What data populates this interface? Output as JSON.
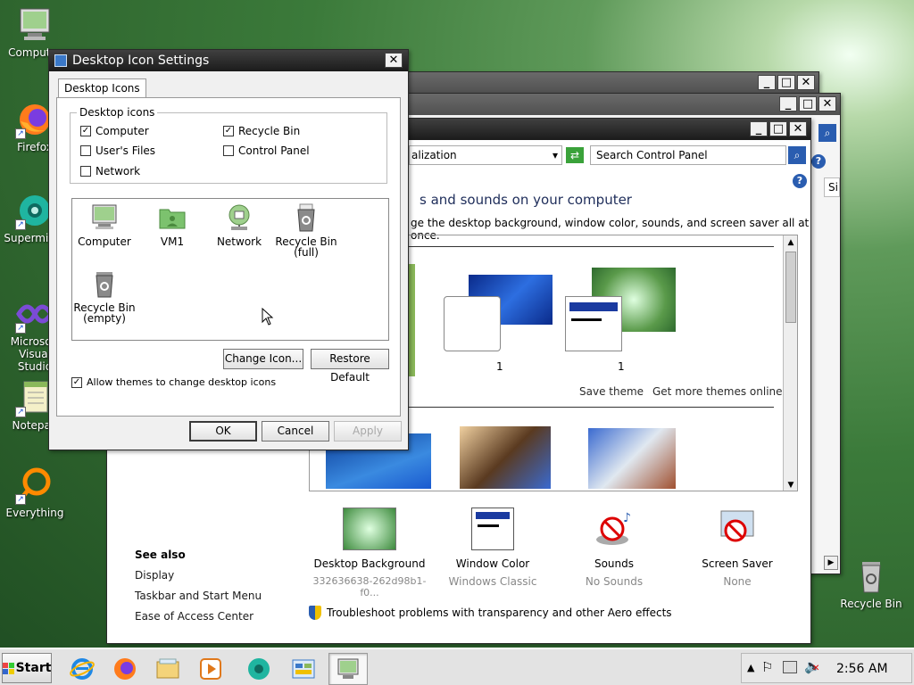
{
  "desktop": {
    "icons": [
      {
        "label": "Computer",
        "icon": "monitor-icon"
      },
      {
        "label": "Firefox",
        "icon": "firefox-icon"
      },
      {
        "label": "Supermium",
        "icon": "supermium-icon"
      },
      {
        "label": "Microsoft Visual Studio",
        "icon": "visual-studio-icon"
      },
      {
        "label": "Notepad",
        "icon": "notepad-icon"
      },
      {
        "label": "Everything",
        "icon": "everything-icon"
      }
    ],
    "recycle_bin_label": "Recycle Bin"
  },
  "dialog": {
    "title": "Desktop Icon Settings",
    "tab": "Desktop Icons",
    "group_label": "Desktop icons",
    "checkboxes": [
      {
        "label": "Computer",
        "checked": true
      },
      {
        "label": "Recycle Bin",
        "checked": true
      },
      {
        "label": "User's Files",
        "checked": false
      },
      {
        "label": "Control Panel",
        "checked": false
      },
      {
        "label": "Network",
        "checked": false
      }
    ],
    "icons": [
      {
        "label": "Computer",
        "icon": "computer-icon"
      },
      {
        "label": "VM1",
        "icon": "user-folder-icon"
      },
      {
        "label": "Network",
        "icon": "network-icon"
      },
      {
        "label": "Recycle Bin (full)",
        "label_line1": "Recycle Bin",
        "label_line2": "(full)",
        "icon": "recycle-bin-full-icon"
      },
      {
        "label": "Recycle Bin (empty)",
        "label_line1": "Recycle Bin",
        "label_line2": "(empty)",
        "icon": "recycle-bin-empty-icon"
      }
    ],
    "change_icon_label": "Change Icon...",
    "restore_default_label": "Restore Default",
    "allow_themes_label": "Allow themes to change desktop icons",
    "allow_themes_checked": true,
    "ok_label": "OK",
    "cancel_label": "Cancel",
    "apply_label": "Apply",
    "close_glyph": "✕"
  },
  "control_panel": {
    "address_text": "alization",
    "search_placeholder": "Search Control Panel",
    "heading": "s and sounds on your computer",
    "subheading": "ge the desktop background, window color, sounds, and screen saver all at once.",
    "theme_counts": [
      "1",
      "1"
    ],
    "save_theme": "Save theme",
    "get_more_themes": "Get more themes online",
    "see_also_title": "See also",
    "see_also": [
      "Display",
      "Taskbar and Start Menu",
      "Ease of Access Center"
    ],
    "bottom_items": [
      {
        "title": "Desktop Background",
        "sub": "332636638-262d98b1-f0...",
        "icon": "desktop-background-icon"
      },
      {
        "title": "Window Color",
        "sub": "Windows Classic",
        "icon": "window-color-icon"
      },
      {
        "title": "Sounds",
        "sub": "No Sounds",
        "icon": "sounds-icon"
      },
      {
        "title": "Screen Saver",
        "sub": "None",
        "icon": "screen-saver-icon"
      }
    ],
    "troubleshoot": "Troubleshoot problems with transparency and other Aero effects",
    "partial_col": "Si"
  },
  "taskbar": {
    "start_label": "Start",
    "apps": [
      "internet-explorer-icon",
      "firefox-icon",
      "file-explorer-icon",
      "media-player-icon",
      "supermium-icon",
      "control-panel-icon",
      "display-settings-icon"
    ],
    "clock": "2:56 AM"
  },
  "colors": {
    "titlebar": "#1b1b1b",
    "selected_theme": "#8ab85a",
    "link": "#1a1a1a"
  }
}
